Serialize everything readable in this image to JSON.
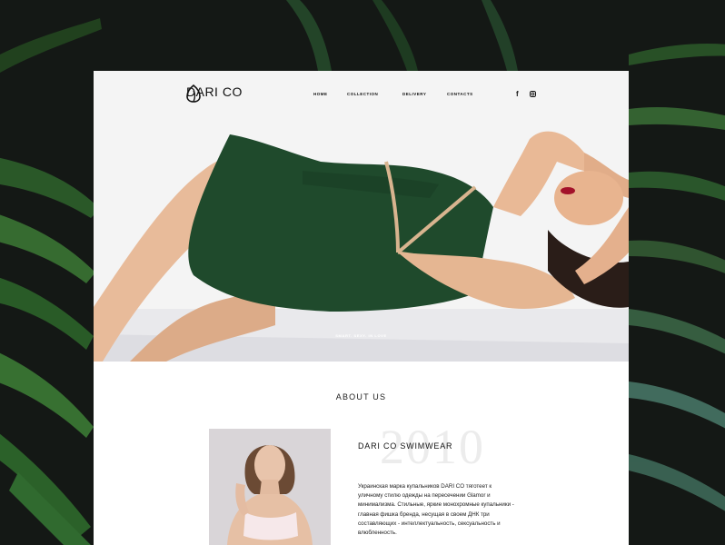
{
  "nav": {
    "logo_text": "DARI CO",
    "items": [
      {
        "label": "HOME"
      },
      {
        "label": "COLLECTION"
      },
      {
        "label": "DELIVERY"
      },
      {
        "label": "CONTACTS"
      }
    ],
    "social": [
      {
        "icon": "facebook-icon",
        "glyph": "f"
      },
      {
        "icon": "instagram-icon"
      }
    ]
  },
  "hero": {
    "tagline": "SMART. SEXY. IN LOVE"
  },
  "about": {
    "title": "ABOUT US",
    "year": "2010",
    "heading": "DARI CO SWIMWEAR",
    "description": "Украинская марка купальников DARI CO тяготеет к уличному стилю одежды на пересечении Glamor и минимализма. Стильные, яркие монохромные купальники - главная фишка бренда, несущая в своем ДНК три составляющих - интеллектуальность, сексуальность и влюбленность."
  },
  "colors": {
    "backdrop": "#141815",
    "swimsuit": "#1f4a2c",
    "leaf": "#2f6a2e"
  }
}
